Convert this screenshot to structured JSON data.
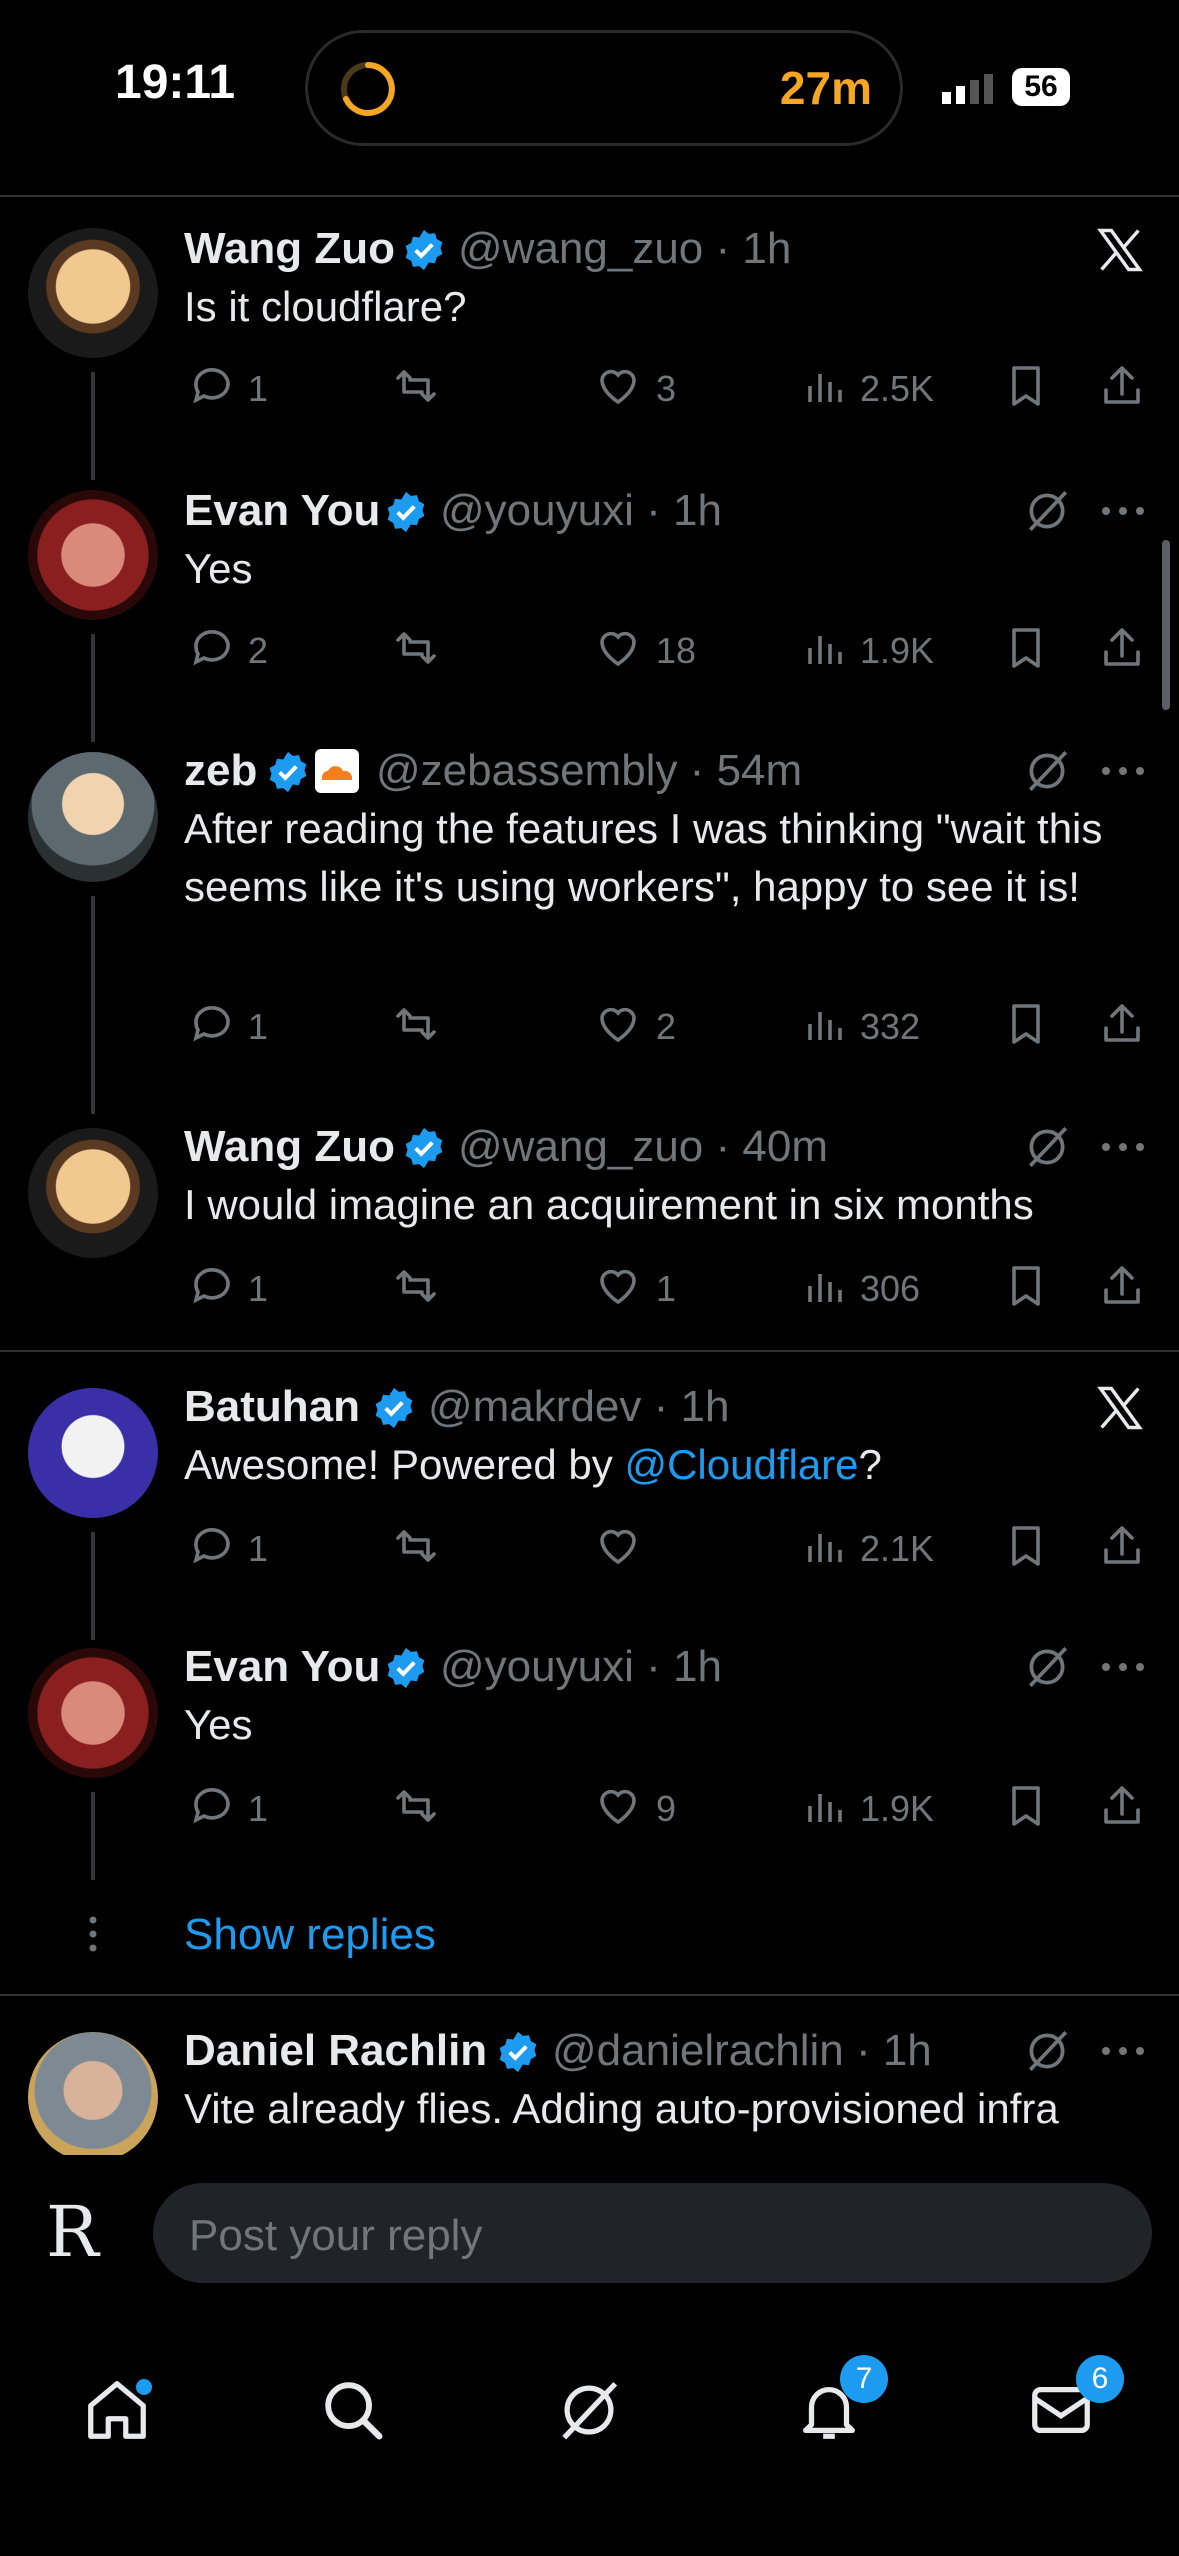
{
  "status_bar": {
    "time": "19:11",
    "timer": "27m",
    "battery": "56"
  },
  "tweets": [
    {
      "name": "Wang Zuo",
      "handle": "@wang_zuo",
      "time": "1h",
      "text": "Is it cloudflare?",
      "replies": "1",
      "likes": "3",
      "views": "2.5K"
    },
    {
      "name": "Evan You",
      "handle": "@youyuxi",
      "time": "1h",
      "text": "Yes",
      "replies": "2",
      "likes": "18",
      "views": "1.9K"
    },
    {
      "name": "zeb",
      "handle": "@zebassembly",
      "time": "54m",
      "text": "After reading the features I was thinking \"wait this seems like it's using workers\", happy to see it is!",
      "replies": "1",
      "likes": "2",
      "views": "332"
    },
    {
      "name": "Wang Zuo",
      "handle": "@wang_zuo",
      "time": "40m",
      "text": "I would imagine an acquirement in six months",
      "replies": "1",
      "likes": "1",
      "views": "306"
    },
    {
      "name": "Batuhan",
      "handle": "@makrdev",
      "time": "1h",
      "text_prefix": "Awesome! Powered by ",
      "mention": "@Cloudflare",
      "text_suffix": "?",
      "replies": "1",
      "likes": "",
      "views": "2.1K"
    },
    {
      "name": "Evan You",
      "handle": "@youyuxi",
      "time": "1h",
      "text": "Yes",
      "replies": "1",
      "likes": "9",
      "views": "1.9K"
    },
    {
      "name": "Daniel Rachlin",
      "handle": "@danielrachlin",
      "time": "1h",
      "text": "Vite already flies. Adding auto-provisioned infra"
    }
  ],
  "show_replies": "Show replies",
  "reply": {
    "placeholder": "Post your reply",
    "logo": "R"
  },
  "tabs": {
    "notifications_badge": "7",
    "messages_badge": "6"
  },
  "colors": {
    "accent": "#1d9bf0",
    "timer": "#f5a623",
    "background": "#000000"
  }
}
